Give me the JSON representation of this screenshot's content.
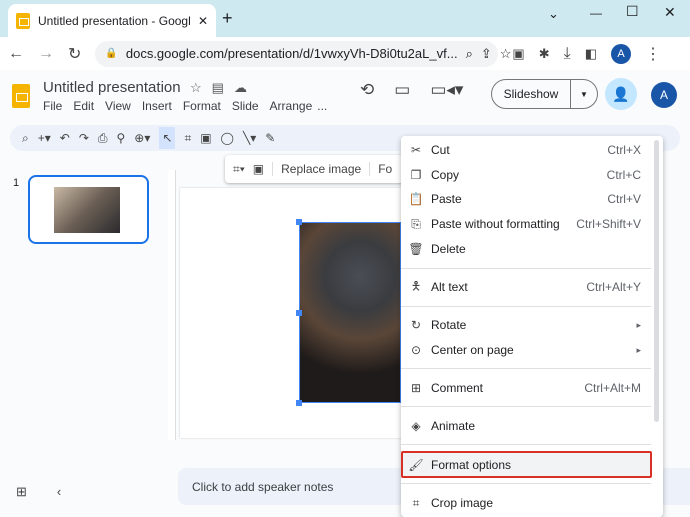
{
  "browser": {
    "tab_title": "Untitled presentation - Google S",
    "new_tab": "+",
    "url": "docs.google.com/presentation/d/1vwxyVh-D8i0tu2aL_vf...",
    "account": "A",
    "window": {
      "chevron": "⌄",
      "min": "—",
      "max": "☐",
      "close": "✕"
    }
  },
  "app": {
    "title": "Untitled presentation",
    "menu": [
      "File",
      "Edit",
      "View",
      "Insert",
      "Format",
      "Slide",
      "Arrange",
      "..."
    ],
    "slideshow": "Slideshow",
    "account": "A"
  },
  "subtoolbar": {
    "replace_image": "Replace image",
    "format": "Fo"
  },
  "filmstrip": {
    "slide_number": "1"
  },
  "notes": {
    "placeholder": "Click to add speaker notes"
  },
  "context_menu": {
    "items": [
      {
        "label": "Cut",
        "shortcut": "Ctrl+X",
        "icon": "scissors-icon"
      },
      {
        "label": "Copy",
        "shortcut": "Ctrl+C",
        "icon": "copy-icon"
      },
      {
        "label": "Paste",
        "shortcut": "Ctrl+V",
        "icon": "paste-icon"
      },
      {
        "label": "Paste without formatting",
        "shortcut": "Ctrl+Shift+V",
        "icon": "paste-plain-icon"
      },
      {
        "label": "Delete",
        "shortcut": "",
        "icon": "trash-icon"
      },
      {
        "label": "Alt text",
        "shortcut": "Ctrl+Alt+Y",
        "icon": "accessibility-icon"
      },
      {
        "label": "Rotate",
        "shortcut": "▸",
        "icon": "rotate-icon"
      },
      {
        "label": "Center on page",
        "shortcut": "▸",
        "icon": "center-icon"
      },
      {
        "label": "Comment",
        "shortcut": "Ctrl+Alt+M",
        "icon": "comment-icon"
      },
      {
        "label": "Animate",
        "shortcut": "",
        "icon": "animate-icon"
      },
      {
        "label": "Format options",
        "shortcut": "",
        "icon": "format-paint-icon"
      },
      {
        "label": "Crop image",
        "shortcut": "",
        "icon": "crop-icon"
      }
    ],
    "highlight_color": "#d93025"
  }
}
